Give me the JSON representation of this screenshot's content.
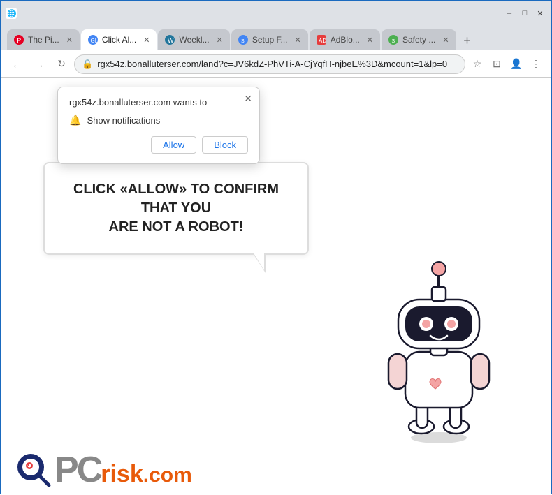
{
  "browser": {
    "title": "Chrome Browser",
    "window_controls": {
      "minimize": "–",
      "maximize": "□",
      "close": "✕"
    },
    "tabs": [
      {
        "id": "tab-pinterest",
        "label": "The Pi...",
        "favicon": "pinterest",
        "active": false,
        "closeable": true
      },
      {
        "id": "tab-click",
        "label": "Click Al...",
        "favicon": "chrome",
        "active": true,
        "closeable": true
      },
      {
        "id": "tab-weekly",
        "label": "Weekl...",
        "favicon": "wp",
        "active": false,
        "closeable": true
      },
      {
        "id": "tab-setup",
        "label": "Setup F...",
        "favicon": "setup",
        "active": false,
        "closeable": true
      },
      {
        "id": "tab-adblock",
        "label": "AdBlo...",
        "favicon": "adblock",
        "active": false,
        "closeable": true
      },
      {
        "id": "tab-safety",
        "label": "Safety ...",
        "favicon": "safety",
        "active": false,
        "closeable": true
      }
    ],
    "address_bar": {
      "url": "rgx54z.bonalluterser.com/land?c=JV6kdZ-PhVTi-A-CjYqfH-njbeE%3D&mcount=1&lp=0",
      "secure_icon": "🔒"
    }
  },
  "notification_popup": {
    "title": "rgx54z.bonalluterser.com wants to",
    "notification_label": "Show notifications",
    "allow_button": "Allow",
    "block_button": "Block",
    "close_icon": "✕"
  },
  "page": {
    "bubble_text_line1": "CLICK «ALLOW» TO CONFIRM THAT YOU",
    "bubble_text_line2": "ARE NOT A ROBOT!"
  },
  "pcrisk": {
    "pc_letters": "PC",
    "risk": "risk",
    "dot_com": ".com"
  },
  "colors": {
    "blue_border": "#1a6abf",
    "orange": "#e85a0a",
    "allow_color": "#1a73e8",
    "block_color": "#1a73e8"
  }
}
